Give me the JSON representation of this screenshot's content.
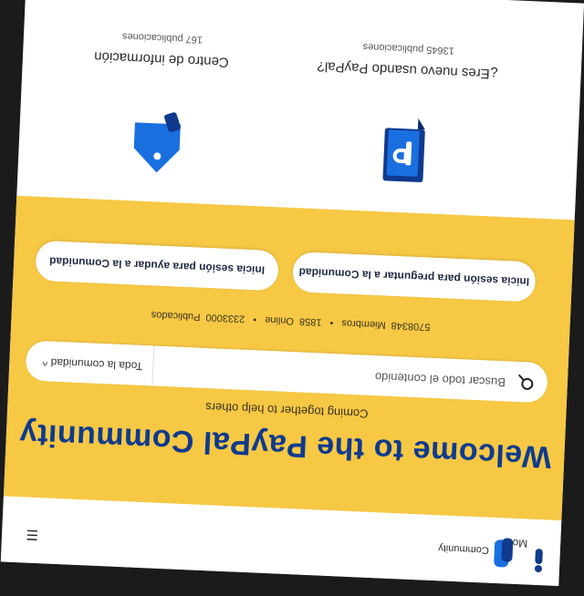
{
  "header": {
    "brand": "Community",
    "more_label": "More",
    "more_caret": "^"
  },
  "hero": {
    "title": "Welcome to the PayPal Community",
    "subtitle": "Coming together to help others",
    "search_placeholder": "Buscar todo el contenido",
    "scope_label": "Toda la comunidad",
    "scope_caret": "^",
    "stats": {
      "members": "5708348",
      "members_label": "Miembros",
      "online": "1858",
      "online_label": "Online",
      "posts": "2333000",
      "posts_label": "Publicados",
      "separator": "•"
    },
    "ask_button": "Inicia sesión para preguntar a la Comunidad",
    "help_button": "Inicia sesión para ayudar a la Comunidad"
  },
  "categories": [
    {
      "title": "¿Eres nuevo usando PayPal?",
      "count": "13645 publicaciones",
      "icon": "paypal-book-icon"
    },
    {
      "title": "Centro de información",
      "count": "167 publicaciones",
      "icon": "tag-icon"
    }
  ],
  "colors": {
    "hero_bg": "#f6c844",
    "brand_blue": "#0f3a8e",
    "icon_blue": "#1a6fe0"
  }
}
